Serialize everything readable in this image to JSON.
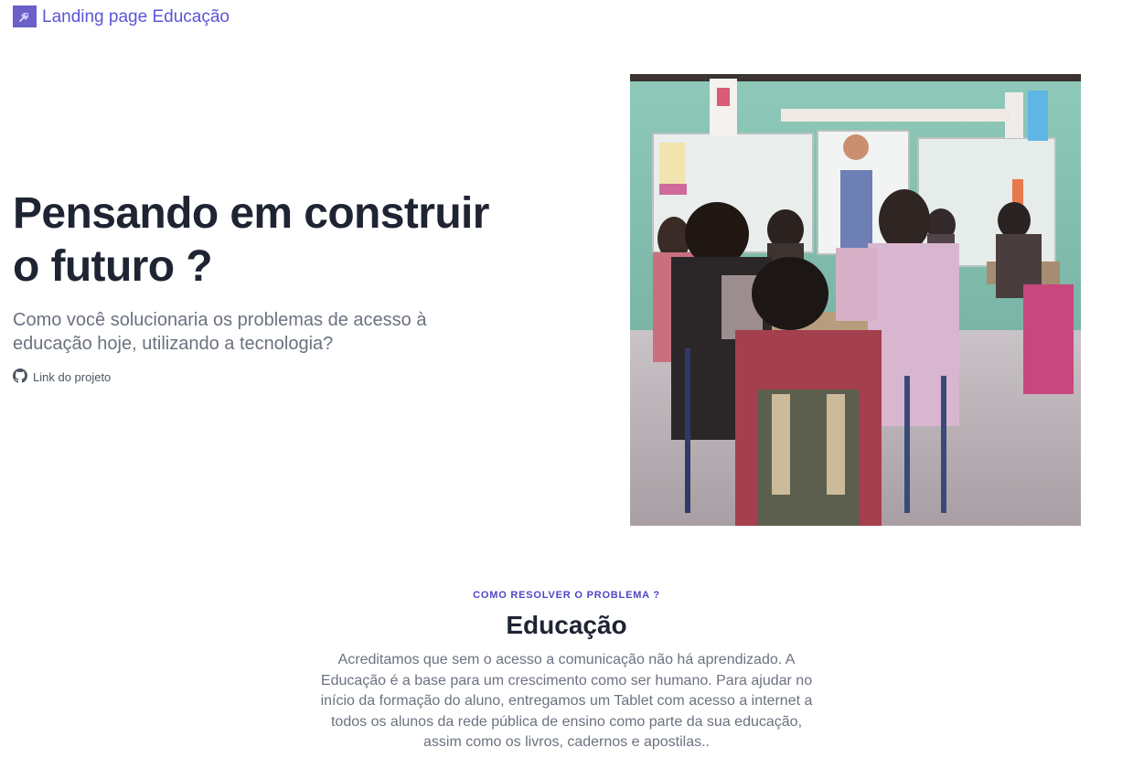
{
  "header": {
    "brand_label": "Landing page Educação",
    "logo_icon": "rocket-icon"
  },
  "hero": {
    "title_line1": "Pensando em construir",
    "title_line2": "o futuro ?",
    "subtitle": "Como você solucionaria os problemas de acesso à educação hoje, utilizando a tecnologia?",
    "project_link_label": "Link do projeto",
    "project_link_icon": "github-icon",
    "image_icon": "classroom-photo"
  },
  "section": {
    "eyebrow": "COMO RESOLVER O PROBLEMA ?",
    "title": "Educação",
    "body": "Acreditamos que sem o acesso a comunicação não há aprendizado. A Educação é a base para um crescimento como ser humano. Para ajudar no início da formação do aluno, entregamos um Tablet com acesso a internet a todos os alunos da rede pública de ensino como parte da sua educação, assim como os livros, cadernos e apostilas.."
  },
  "colors": {
    "accent": "#5b55d6",
    "heading": "#1f2433",
    "muted": "#6b7280"
  }
}
